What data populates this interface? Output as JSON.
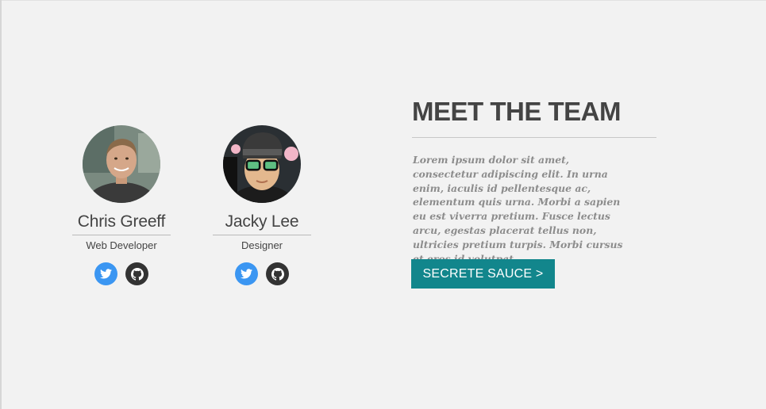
{
  "team": {
    "members": [
      {
        "name": "Chris Greeff",
        "role": "Web Developer",
        "socials": [
          {
            "network": "twitter",
            "icon": "twitter-bird-icon",
            "color": "#3b96f2"
          },
          {
            "network": "github",
            "icon": "github-octocat-icon",
            "color": "#333333"
          }
        ]
      },
      {
        "name": "Jacky Lee",
        "role": "Designer",
        "socials": [
          {
            "network": "twitter",
            "icon": "twitter-bird-icon",
            "color": "#3b96f2"
          },
          {
            "network": "github",
            "icon": "github-octocat-icon",
            "color": "#333333"
          }
        ]
      }
    ],
    "title": "MEET THE TEAM",
    "description": "Lorem ipsum dolor sit amet, consectetur adipiscing elit. In urna enim, iaculis id pellentesque ac, elementum quis urna. Morbi a sapien eu est viverra pretium. Fusce lectus arcu, egestas placerat tellus non, ultricies pretium turpis. Morbi cursus et eros id volutpat.",
    "cta_label": "SECRETE SAUCE  >"
  },
  "colors": {
    "background": "#f2f2f2",
    "text_dark": "#444444",
    "text_muted": "#8c8c8c",
    "cta_background": "#12868c",
    "twitter": "#3b96f2",
    "github": "#333333"
  }
}
